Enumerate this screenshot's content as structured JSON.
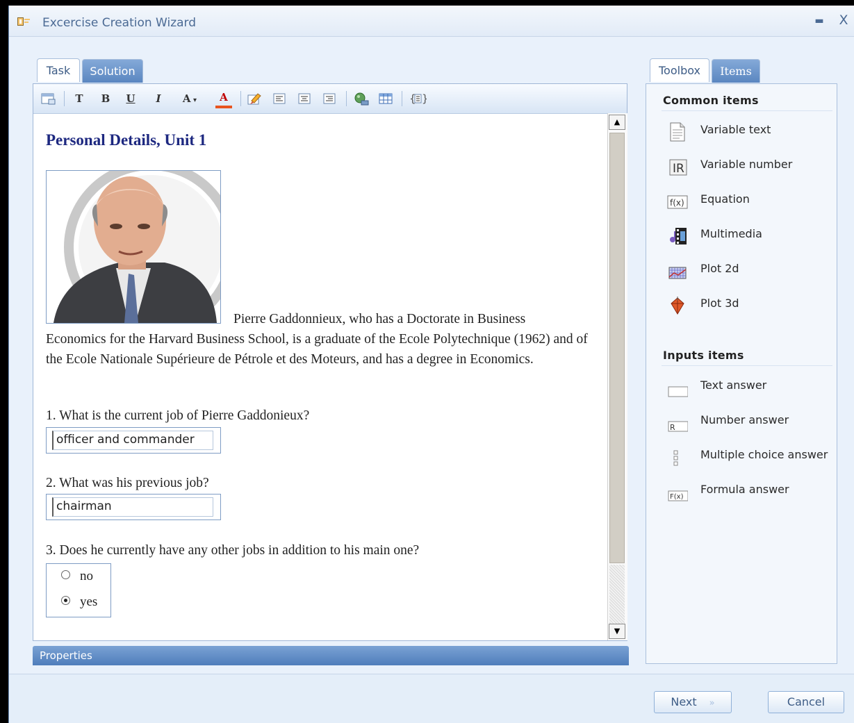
{
  "window": {
    "title": "Excercise Creation Wizard"
  },
  "editor_tabs": [
    {
      "label": "Task"
    },
    {
      "label": "Solution"
    }
  ],
  "toolbar": {
    "bold": "B",
    "underline": "U",
    "italic": "I",
    "font_size": "A",
    "font_color": "A"
  },
  "document": {
    "title": "Personal Details, Unit 1",
    "intro_line1": "Pierre Gaddonnieux, who has a Doctorate in Business",
    "intro_rest": "Economics for the Harvard Business School, is a graduate of the Ecole Polytechnique (1962) and of the Ecole Nationale Supérieure de Pétrole et des Moteurs, and has a degree in Economics.",
    "q1": "1. What is the current job of Pierre Gaddonieux?",
    "a1": "officer and commander",
    "q2": "2. What was his previous job?",
    "a2": "chairman",
    "q3": "3. Does he currently have any other jobs in addition to his main one?",
    "options": [
      {
        "label": "no",
        "checked": false
      },
      {
        "label": "yes",
        "checked": true
      }
    ]
  },
  "properties": {
    "label": "Properties"
  },
  "toolbox_tabs": [
    {
      "label": "Toolbox"
    },
    {
      "label": "Items"
    }
  ],
  "toolbox": {
    "common_title": "Common items",
    "common_items": [
      {
        "label": "Variable text",
        "icon": "document-icon"
      },
      {
        "label": "Variable number",
        "icon": "real-number-icon"
      },
      {
        "label": "Equation",
        "icon": "function-icon"
      },
      {
        "label": "Multimedia",
        "icon": "film-icon"
      },
      {
        "label": "Plot 2d",
        "icon": "grid-plot-icon"
      },
      {
        "label": "Plot 3d",
        "icon": "3d-plot-icon"
      }
    ],
    "inputs_title": "Inputs items",
    "input_items": [
      {
        "label": "Text answer",
        "icon": "text-field-icon"
      },
      {
        "label": "Number answer",
        "icon": "number-field-icon"
      },
      {
        "label": "Multiple choice answer",
        "icon": "checkbox-list-icon"
      },
      {
        "label": "Formula answer",
        "icon": "formula-field-icon"
      }
    ]
  },
  "footer": {
    "next": "Next",
    "next_arrows": "»",
    "cancel": "Cancel"
  },
  "colors": {
    "title": "#1d2880",
    "tab_active_bg": "#ffffff",
    "tab_inactive_bg": "#5a86c0",
    "properties_bg": "#4f7dbb"
  }
}
